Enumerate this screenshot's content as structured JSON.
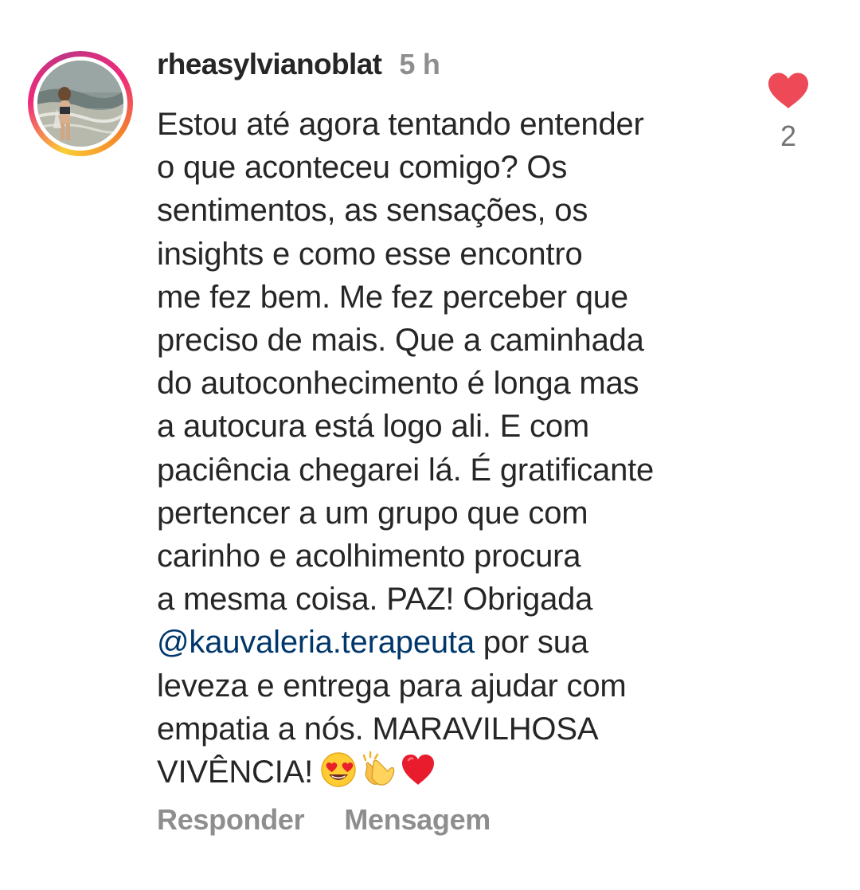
{
  "comment": {
    "username": "rheasylvianoblat",
    "timestamp": "5 h",
    "lines": [
      "Estou até agora tentando entender",
      "o que aconteceu comigo? Os",
      "sentimentos, as sensações, os",
      "insights e como esse encontro",
      "me fez bem. Me fez perceber que",
      "preciso de mais. Que a caminhada",
      "do autoconhecimento é longa mas",
      "a autocura está logo ali. E com",
      "paciência chegarei lá. É gratificante",
      "pertencer a um grupo que com",
      "carinho e acolhimento procura",
      "a mesma coisa. PAZ! Obrigada"
    ],
    "mention": "@kauvaleria.terapeuta",
    "mention_suffix": " por sua",
    "lines_after": [
      "leveza e entrega para ajudar com",
      "empatia a nós. MARAVILHOSA"
    ],
    "last_line": "VIVÊNCIA!",
    "emojis": [
      "heart-eyes-emoji",
      "clapping-hands-emoji",
      "red-heart-emoji"
    ],
    "like_count": "2",
    "like_icon": "heart-icon",
    "like_color": "#ed4956"
  },
  "actions": {
    "reply": "Responder",
    "message": "Mensagem"
  },
  "colors": {
    "text": "#262626",
    "secondary": "#8e8e8e",
    "mention": "#00376b",
    "like": "#ed4956"
  }
}
